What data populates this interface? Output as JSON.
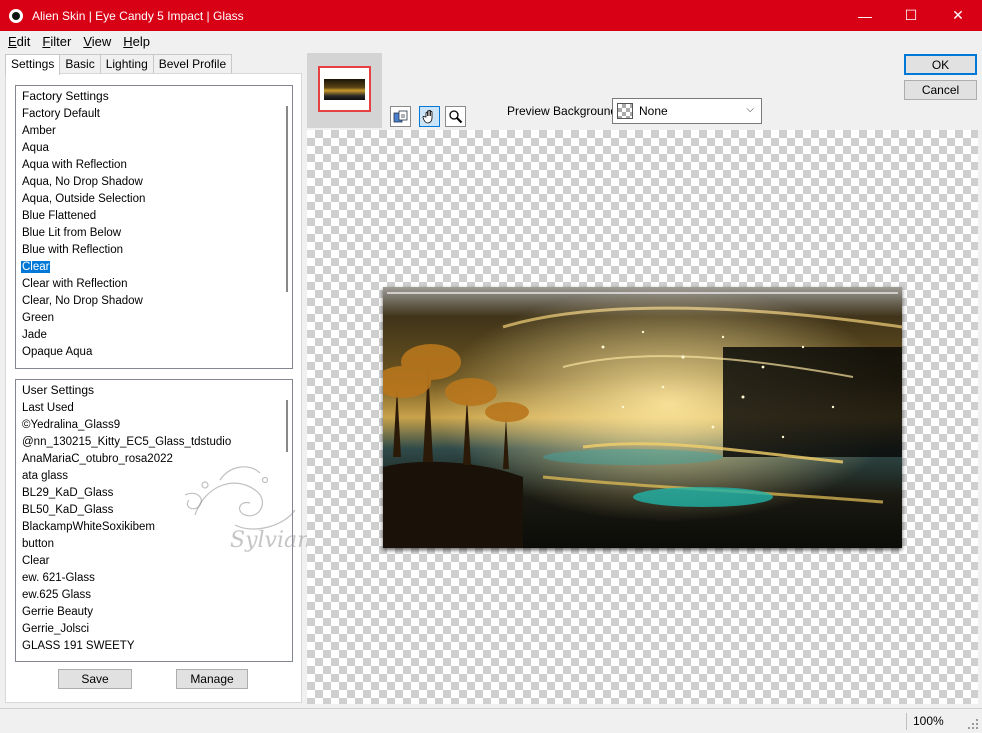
{
  "window": {
    "title": "Alien Skin | Eye Candy 5 Impact | Glass",
    "minimize_glyph": "—",
    "maximize_glyph": "☐",
    "close_glyph": "✕"
  },
  "menu": {
    "edit": {
      "accel": "E",
      "rest": "dit"
    },
    "filter": {
      "accel": "F",
      "rest": "ilter"
    },
    "view": {
      "accel": "V",
      "rest": "iew"
    },
    "help": {
      "accel": "H",
      "rest": "elp"
    }
  },
  "tabs": {
    "settings": "Settings",
    "basic": "Basic",
    "lighting": "Lighting",
    "bevel_profile": "Bevel Profile"
  },
  "factory_settings": {
    "header": "Factory Settings",
    "items": [
      "Factory Default",
      "Amber",
      "Aqua",
      "Aqua with Reflection",
      "Aqua, No Drop Shadow",
      "Aqua, Outside Selection",
      "Blue Flattened",
      "Blue Lit from Below",
      "Blue with Reflection",
      "Clear",
      "Clear with Reflection",
      "Clear, No Drop Shadow",
      "Green",
      "Jade",
      "Opaque Aqua"
    ],
    "selected": "Clear"
  },
  "user_settings": {
    "header": "User Settings",
    "items": [
      "Last Used",
      "©Yedralina_Glass9",
      "@nn_130215_Kitty_EC5_Glass_tdstudio",
      "AnaMariaC_otubro_rosa2022",
      "ata glass",
      "BL29_KaD_Glass",
      "BL50_KaD_Glass",
      "BlackampWhiteSoxikibem",
      "button",
      "Clear",
      "ew. 621-Glass",
      "ew.625 Glass",
      "Gerrie Beauty",
      "Gerrie_Jolsci",
      "GLASS 191 SWEETY"
    ]
  },
  "buttons": {
    "save": "Save",
    "manage": "Manage",
    "ok": "OK",
    "cancel": "Cancel"
  },
  "preview_background": {
    "label": "Preview Background:",
    "value": "None"
  },
  "tools": [
    "compare-icon",
    "hand-icon",
    "zoom-icon"
  ],
  "watermark_signature": "Sylviane",
  "status": {
    "zoom": "100%"
  },
  "colors": {
    "titlebar": "#d70015",
    "selection": "#0078d7",
    "thumbnail_border": "#e64040"
  }
}
